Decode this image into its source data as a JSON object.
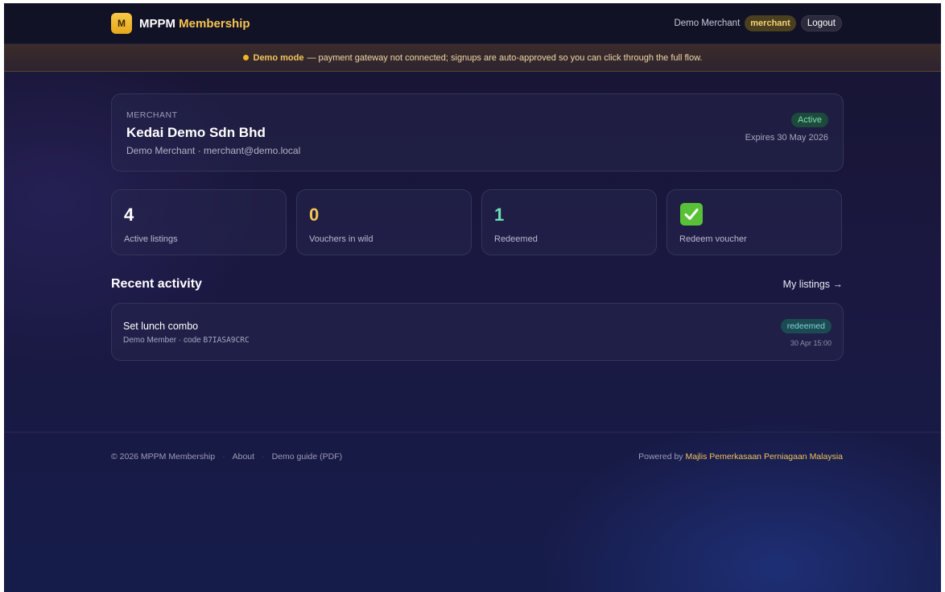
{
  "header": {
    "logo_letter": "M",
    "brand_part1": "MPPM",
    "brand_part2": "Membership",
    "user_name": "Demo Merchant",
    "role": "merchant",
    "logout_label": "Logout"
  },
  "banner": {
    "strong": "Demo mode",
    "text": "— payment gateway not connected; signups are auto-approved so you can click through the full flow."
  },
  "merchant": {
    "eyebrow": "MERCHANT",
    "name": "Kedai Demo Sdn Bhd",
    "subtitle": "Demo Merchant · merchant@demo.local",
    "status": "Active",
    "expiry": "Expires 30 May 2026"
  },
  "stats": [
    {
      "value": "4",
      "label": "Active listings",
      "color": "#ffffff"
    },
    {
      "value": "0",
      "label": "Vouchers in wild",
      "color": "#f5c451"
    },
    {
      "value": "1",
      "label": "Redeemed",
      "color": "#6fe0b8"
    },
    {
      "icon": "check-mark-icon",
      "label": "Redeem voucher",
      "color": "#59c137"
    }
  ],
  "activity": {
    "title": "Recent activity",
    "link_label": "My listings →",
    "items": [
      {
        "title": "Set lunch combo",
        "member": "Demo Member · code",
        "code": "B7IASA9CRC",
        "status": "redeemed",
        "time": "30 Apr 15:00"
      }
    ]
  },
  "footer": {
    "copyright": "© 2026 MPPM Membership",
    "about": "About",
    "guide": "Demo guide (PDF)",
    "powered_by": "Powered by",
    "org": "Majlis Pemerkasaan Perniagaan Malaysia"
  }
}
